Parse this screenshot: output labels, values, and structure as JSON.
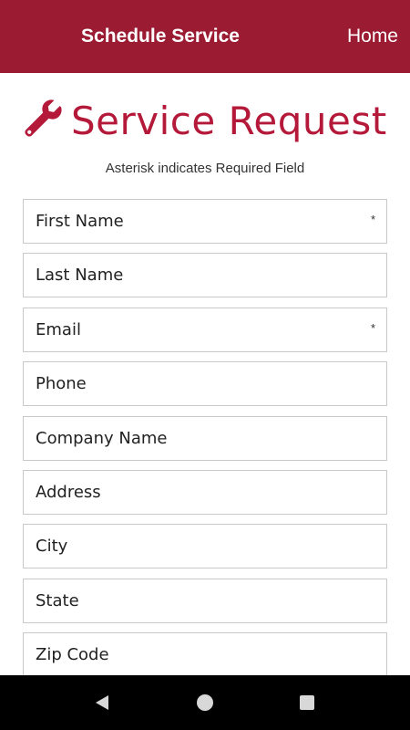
{
  "app_bar": {
    "title": "Schedule Service",
    "home_label": "Home",
    "color": "#9b1b33"
  },
  "heading": {
    "icon": "wrench-icon",
    "text": "Service Request",
    "color": "#b5193a"
  },
  "required_note": "Asterisk indicates Required Field",
  "required_marker": "*",
  "form": {
    "fields": [
      {
        "placeholder": "First Name",
        "value": "",
        "required": true
      },
      {
        "placeholder": "Last Name",
        "value": "",
        "required": false
      },
      {
        "placeholder": "Email",
        "value": "",
        "required": true
      },
      {
        "placeholder": "Phone",
        "value": "",
        "required": false
      },
      {
        "placeholder": "Company Name",
        "value": "",
        "required": false
      },
      {
        "placeholder": "Address",
        "value": "",
        "required": false
      },
      {
        "placeholder": "City",
        "value": "",
        "required": false
      },
      {
        "placeholder": "State",
        "value": "",
        "required": false
      },
      {
        "placeholder": "Zip Code",
        "value": "",
        "required": false
      }
    ]
  },
  "nav_bar": {
    "back_icon": "back-triangle-icon",
    "home_icon": "home-circle-icon",
    "recent_icon": "recent-square-icon"
  }
}
